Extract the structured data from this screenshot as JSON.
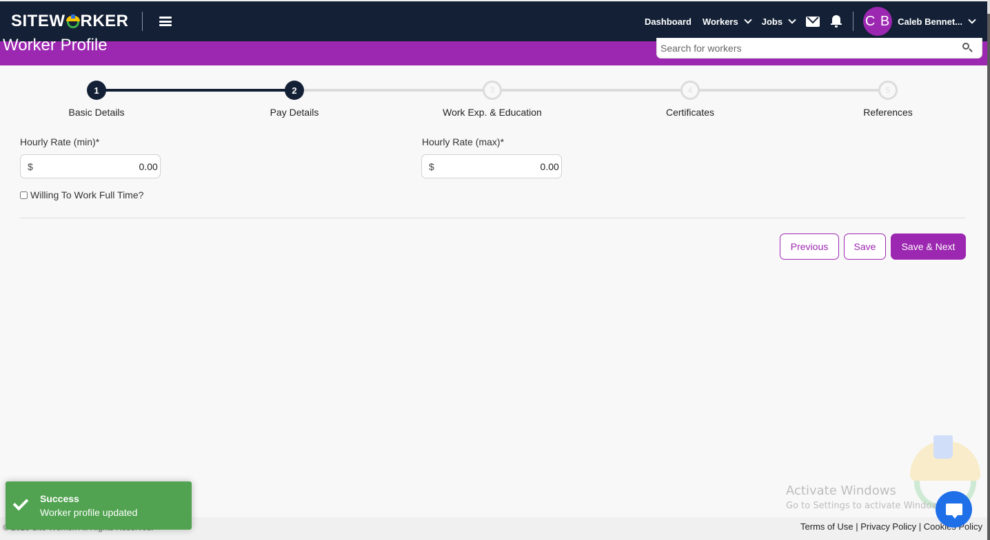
{
  "navbar": {
    "brand": {
      "prefix": "SITEW",
      "suffix": "RKER"
    },
    "links": [
      {
        "label": "Dashboard",
        "has_dropdown": false
      },
      {
        "label": "Workers",
        "has_dropdown": true
      },
      {
        "label": "Jobs",
        "has_dropdown": true
      }
    ],
    "icons": [
      "menu-icon",
      "mail-icon",
      "bell-icon"
    ],
    "user": {
      "initials": "C B",
      "name": "Caleb Bennet...",
      "avatar_color": "#9c27b0"
    }
  },
  "header": {
    "title": "Worker Profile",
    "search_placeholder": "Search for workers",
    "band_color": "#9c27b0"
  },
  "stepper": {
    "current_step": 2,
    "steps": [
      {
        "number": "1",
        "label": "Basic Details",
        "status": "complete"
      },
      {
        "number": "2",
        "label": "Pay Details",
        "status": "active"
      },
      {
        "number": "3",
        "label": "Work Exp. & Education",
        "status": "pending"
      },
      {
        "number": "4",
        "label": "Certificates",
        "status": "pending"
      },
      {
        "number": "5",
        "label": "References",
        "status": "pending"
      }
    ]
  },
  "form": {
    "min_rate": {
      "label": "Hourly Rate (min)*",
      "currency": "$",
      "value": "0.00"
    },
    "max_rate": {
      "label": "Hourly Rate (max)*",
      "currency": "$",
      "value": "0.00"
    },
    "full_time": {
      "label": "Willing To Work Full Time?",
      "checked": false
    }
  },
  "actions": {
    "previous": "Previous",
    "save": "Save",
    "save_next": "Save & Next"
  },
  "toast": {
    "title": "Success",
    "message": "Worker profile updated",
    "color": "#51a351"
  },
  "footer": {
    "copyright": "© 2023 Site Worker. All Rights Reserved.",
    "links": [
      "Terms of Use",
      "Privacy Policy",
      "Cookies Policy"
    ],
    "separator": " | "
  },
  "os_overlay": {
    "title": "Activate Windows",
    "subtitle": "Go to Settings to activate Windows."
  }
}
